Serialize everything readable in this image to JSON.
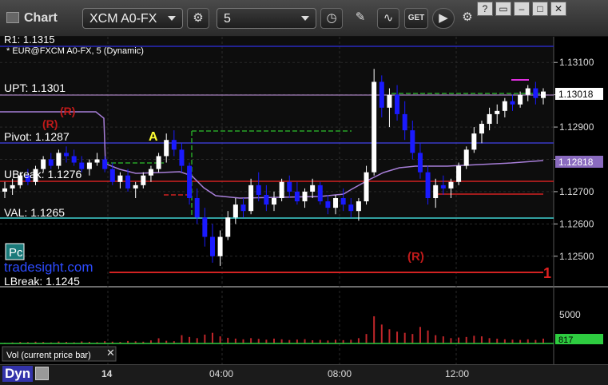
{
  "window": {
    "title": "Chart",
    "symbol": "XCM A0-FX",
    "interval": "5",
    "get_label": "GET"
  },
  "legend": {
    "price_title": "* EUR@FXCM A0-FX, 5 (Dynamic)",
    "volume_title": "Vol (current price bar)"
  },
  "bottom": {
    "mode": "Dyn"
  },
  "colors": {
    "up": "#ffffff",
    "down": "#1a1aff",
    "volume_bar": "#c0262a",
    "volume_mark": "#2ecc40",
    "pivot_green": "#27a427",
    "res_red": "#d22222",
    "ma": "#a77ed8",
    "val_cyan": "#3fd2d2"
  },
  "labels": {
    "r1": "R1: 1.1315",
    "upt": "UPT: 1.1301",
    "pivot": "Pivot: 1.1287",
    "ubreak": "UBreak: 1.1276",
    "val": "VAL: 1.1265",
    "lbreak": "LBreak: 1.1245",
    "watermark": "tradesight.com",
    "pc": "Pc",
    "a_marker": "A",
    "r_marker": "(R)",
    "one_marker": "1",
    "last_price": "1.13018",
    "ma_price": "1.12818",
    "vol_last": "817"
  },
  "chart_data": {
    "type": "candlestick",
    "ylim": [
      1.1245,
      1.1315
    ],
    "yticks": [
      "1.13100",
      "1.13000",
      "1.12900",
      "1.12800",
      "1.12700",
      "1.12600",
      "1.12500"
    ],
    "xticks": [
      "14",
      "04:00",
      "08:00",
      "12:00"
    ],
    "volume_ticks": [
      "5000"
    ],
    "ohlc": [
      [
        1.127,
        1.1273,
        1.1268,
        1.1271
      ],
      [
        1.1271,
        1.1274,
        1.1269,
        1.1272
      ],
      [
        1.1272,
        1.1276,
        1.1271,
        1.1275
      ],
      [
        1.1275,
        1.1277,
        1.1272,
        1.1273
      ],
      [
        1.1273,
        1.1278,
        1.1272,
        1.1277
      ],
      [
        1.1277,
        1.1281,
        1.1276,
        1.128
      ],
      [
        1.128,
        1.1282,
        1.1277,
        1.1278
      ],
      [
        1.1278,
        1.1283,
        1.1277,
        1.1282
      ],
      [
        1.1282,
        1.1284,
        1.1279,
        1.1281
      ],
      [
        1.1281,
        1.1283,
        1.1278,
        1.1279
      ],
      [
        1.1279,
        1.1281,
        1.1276,
        1.1277
      ],
      [
        1.1277,
        1.128,
        1.1275,
        1.1279
      ],
      [
        1.1279,
        1.1282,
        1.1278,
        1.128
      ],
      [
        1.128,
        1.1281,
        1.1276,
        1.1277
      ],
      [
        1.1277,
        1.1279,
        1.1272,
        1.1273
      ],
      [
        1.1273,
        1.1276,
        1.1271,
        1.1275
      ],
      [
        1.1275,
        1.1277,
        1.127,
        1.1271
      ],
      [
        1.1271,
        1.1273,
        1.1268,
        1.1272
      ],
      [
        1.1272,
        1.1276,
        1.1271,
        1.1275
      ],
      [
        1.1275,
        1.1278,
        1.1273,
        1.1277
      ],
      [
        1.1277,
        1.1282,
        1.1276,
        1.1281
      ],
      [
        1.1281,
        1.1288,
        1.1279,
        1.1286
      ],
      [
        1.1286,
        1.1289,
        1.1281,
        1.1283
      ],
      [
        1.1283,
        1.1285,
        1.1276,
        1.1278
      ],
      [
        1.1278,
        1.1279,
        1.1266,
        1.1268
      ],
      [
        1.1268,
        1.1271,
        1.126,
        1.1262
      ],
      [
        1.1262,
        1.1265,
        1.1253,
        1.1256
      ],
      [
        1.1256,
        1.126,
        1.1248,
        1.125
      ],
      [
        1.125,
        1.1258,
        1.1247,
        1.1256
      ],
      [
        1.1256,
        1.1264,
        1.1255,
        1.1262
      ],
      [
        1.1262,
        1.1268,
        1.126,
        1.1266
      ],
      [
        1.1266,
        1.1268,
        1.1262,
        1.1264
      ],
      [
        1.1264,
        1.1274,
        1.1263,
        1.1272
      ],
      [
        1.1272,
        1.1276,
        1.1267,
        1.1269
      ],
      [
        1.1269,
        1.1272,
        1.1264,
        1.1266
      ],
      [
        1.1266,
        1.127,
        1.1264,
        1.1268
      ],
      [
        1.1268,
        1.1274,
        1.1267,
        1.1273
      ],
      [
        1.1273,
        1.1275,
        1.1268,
        1.127
      ],
      [
        1.127,
        1.1273,
        1.1266,
        1.1267
      ],
      [
        1.1267,
        1.1271,
        1.1265,
        1.127
      ],
      [
        1.127,
        1.1274,
        1.1268,
        1.1272
      ],
      [
        1.1272,
        1.1273,
        1.1266,
        1.1267
      ],
      [
        1.1267,
        1.1269,
        1.1263,
        1.1265
      ],
      [
        1.1265,
        1.1269,
        1.1263,
        1.1268
      ],
      [
        1.1268,
        1.1271,
        1.1264,
        1.1266
      ],
      [
        1.1266,
        1.1268,
        1.1262,
        1.1264
      ],
      [
        1.1264,
        1.1268,
        1.1261,
        1.1267
      ],
      [
        1.1267,
        1.1278,
        1.1266,
        1.1276
      ],
      [
        1.1276,
        1.1308,
        1.1275,
        1.1304
      ],
      [
        1.1304,
        1.1306,
        1.1293,
        1.1296
      ],
      [
        1.1296,
        1.1302,
        1.129,
        1.13
      ],
      [
        1.13,
        1.1303,
        1.1292,
        1.1294
      ],
      [
        1.1294,
        1.1298,
        1.1286,
        1.1289
      ],
      [
        1.1289,
        1.1292,
        1.128,
        1.1282
      ],
      [
        1.1282,
        1.1285,
        1.1274,
        1.1276
      ],
      [
        1.1276,
        1.1278,
        1.1266,
        1.1268
      ],
      [
        1.1268,
        1.1274,
        1.1265,
        1.1272
      ],
      [
        1.1272,
        1.1275,
        1.1269,
        1.1271
      ],
      [
        1.1271,
        1.1274,
        1.1268,
        1.1273
      ],
      [
        1.1273,
        1.1279,
        1.1272,
        1.1278
      ],
      [
        1.1278,
        1.1284,
        1.1277,
        1.1283
      ],
      [
        1.1283,
        1.129,
        1.1282,
        1.1288
      ],
      [
        1.1288,
        1.1292,
        1.1285,
        1.1291
      ],
      [
        1.1291,
        1.1296,
        1.1289,
        1.1294
      ],
      [
        1.1294,
        1.1297,
        1.1291,
        1.1295
      ],
      [
        1.1295,
        1.1299,
        1.1293,
        1.1298
      ],
      [
        1.1298,
        1.13,
        1.1295,
        1.1297
      ],
      [
        1.1297,
        1.1301,
        1.1296,
        1.13
      ],
      [
        1.13,
        1.1303,
        1.1298,
        1.1302
      ],
      [
        1.1302,
        1.1304,
        1.1297,
        1.1299
      ],
      [
        1.1299,
        1.1302,
        1.1297,
        1.1301
      ]
    ],
    "volume": [
      120,
      180,
      260,
      220,
      300,
      240,
      180,
      320,
      260,
      200,
      340,
      280,
      220,
      380,
      300,
      260,
      420,
      360,
      300,
      520,
      880,
      460,
      380,
      1400,
      1100,
      900,
      1500,
      1800,
      1200,
      960,
      820,
      700,
      900,
      780,
      640,
      820,
      700,
      580,
      660,
      720,
      540,
      600,
      500,
      640,
      560,
      620,
      900,
      1600,
      4600,
      3200,
      2400,
      2000,
      1800,
      1600,
      2800,
      2200,
      1400,
      1200,
      900,
      1000,
      1100,
      1300,
      1200,
      900,
      800,
      700,
      650,
      600,
      700,
      600,
      817
    ]
  }
}
